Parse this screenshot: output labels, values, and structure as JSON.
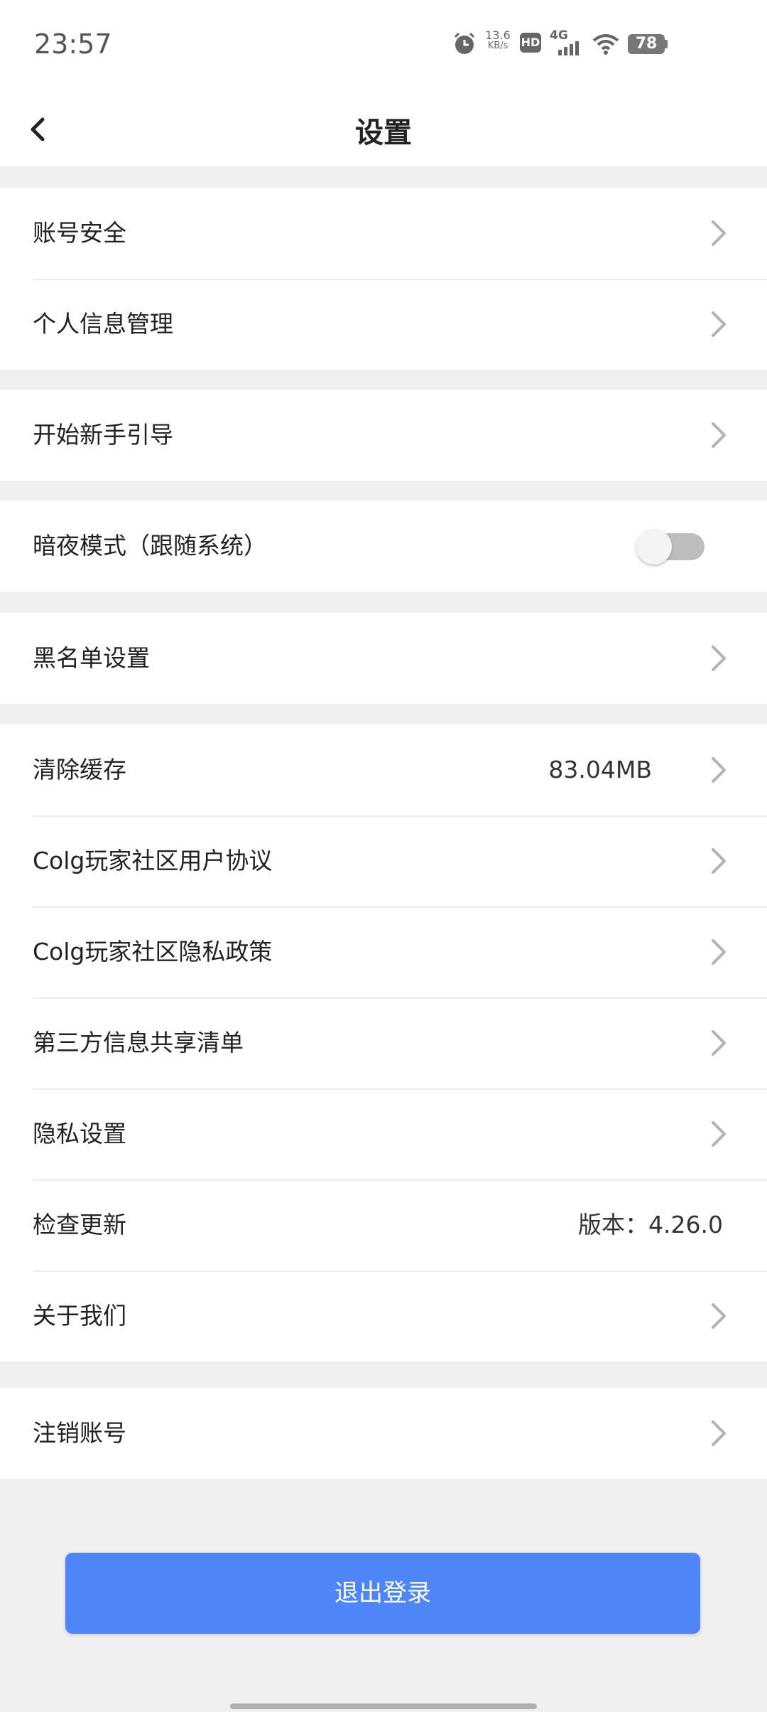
{
  "status_bar": {
    "time": "23:57",
    "net_speed_value": "13.6",
    "net_speed_unit": "KB/s",
    "hd_label": "HD",
    "network": "4G",
    "battery": "78",
    "icons": [
      "alarm-icon",
      "hd-icon",
      "signal-icon",
      "wifi-icon",
      "battery-icon"
    ]
  },
  "header": {
    "title": "设置",
    "back_icon": "chevron-left-icon"
  },
  "sections": {
    "account": {
      "items": [
        {
          "label": "账号安全"
        },
        {
          "label": "个人信息管理"
        }
      ]
    },
    "guide": {
      "items": [
        {
          "label": "开始新手引导"
        }
      ]
    },
    "dark_mode": {
      "label": "暗夜模式（跟随系统）",
      "enabled": false
    },
    "blacklist": {
      "items": [
        {
          "label": "黑名单设置"
        }
      ]
    },
    "general": {
      "items": [
        {
          "label": "清除缓存",
          "value": "83.04MB"
        },
        {
          "label": "Colg玩家社区用户协议"
        },
        {
          "label": "Colg玩家社区隐私政策"
        },
        {
          "label": "第三方信息共享清单"
        },
        {
          "label": "隐私设置"
        },
        {
          "label": "检查更新",
          "value": "版本：4.26.0"
        },
        {
          "label": "关于我们"
        }
      ]
    },
    "cancel": {
      "items": [
        {
          "label": "注销账号"
        }
      ]
    }
  },
  "logout_button": "退出登录",
  "colors": {
    "accent": "#4f86f7",
    "background": "#f0f0f0",
    "chevron": "#b3b3b3"
  }
}
